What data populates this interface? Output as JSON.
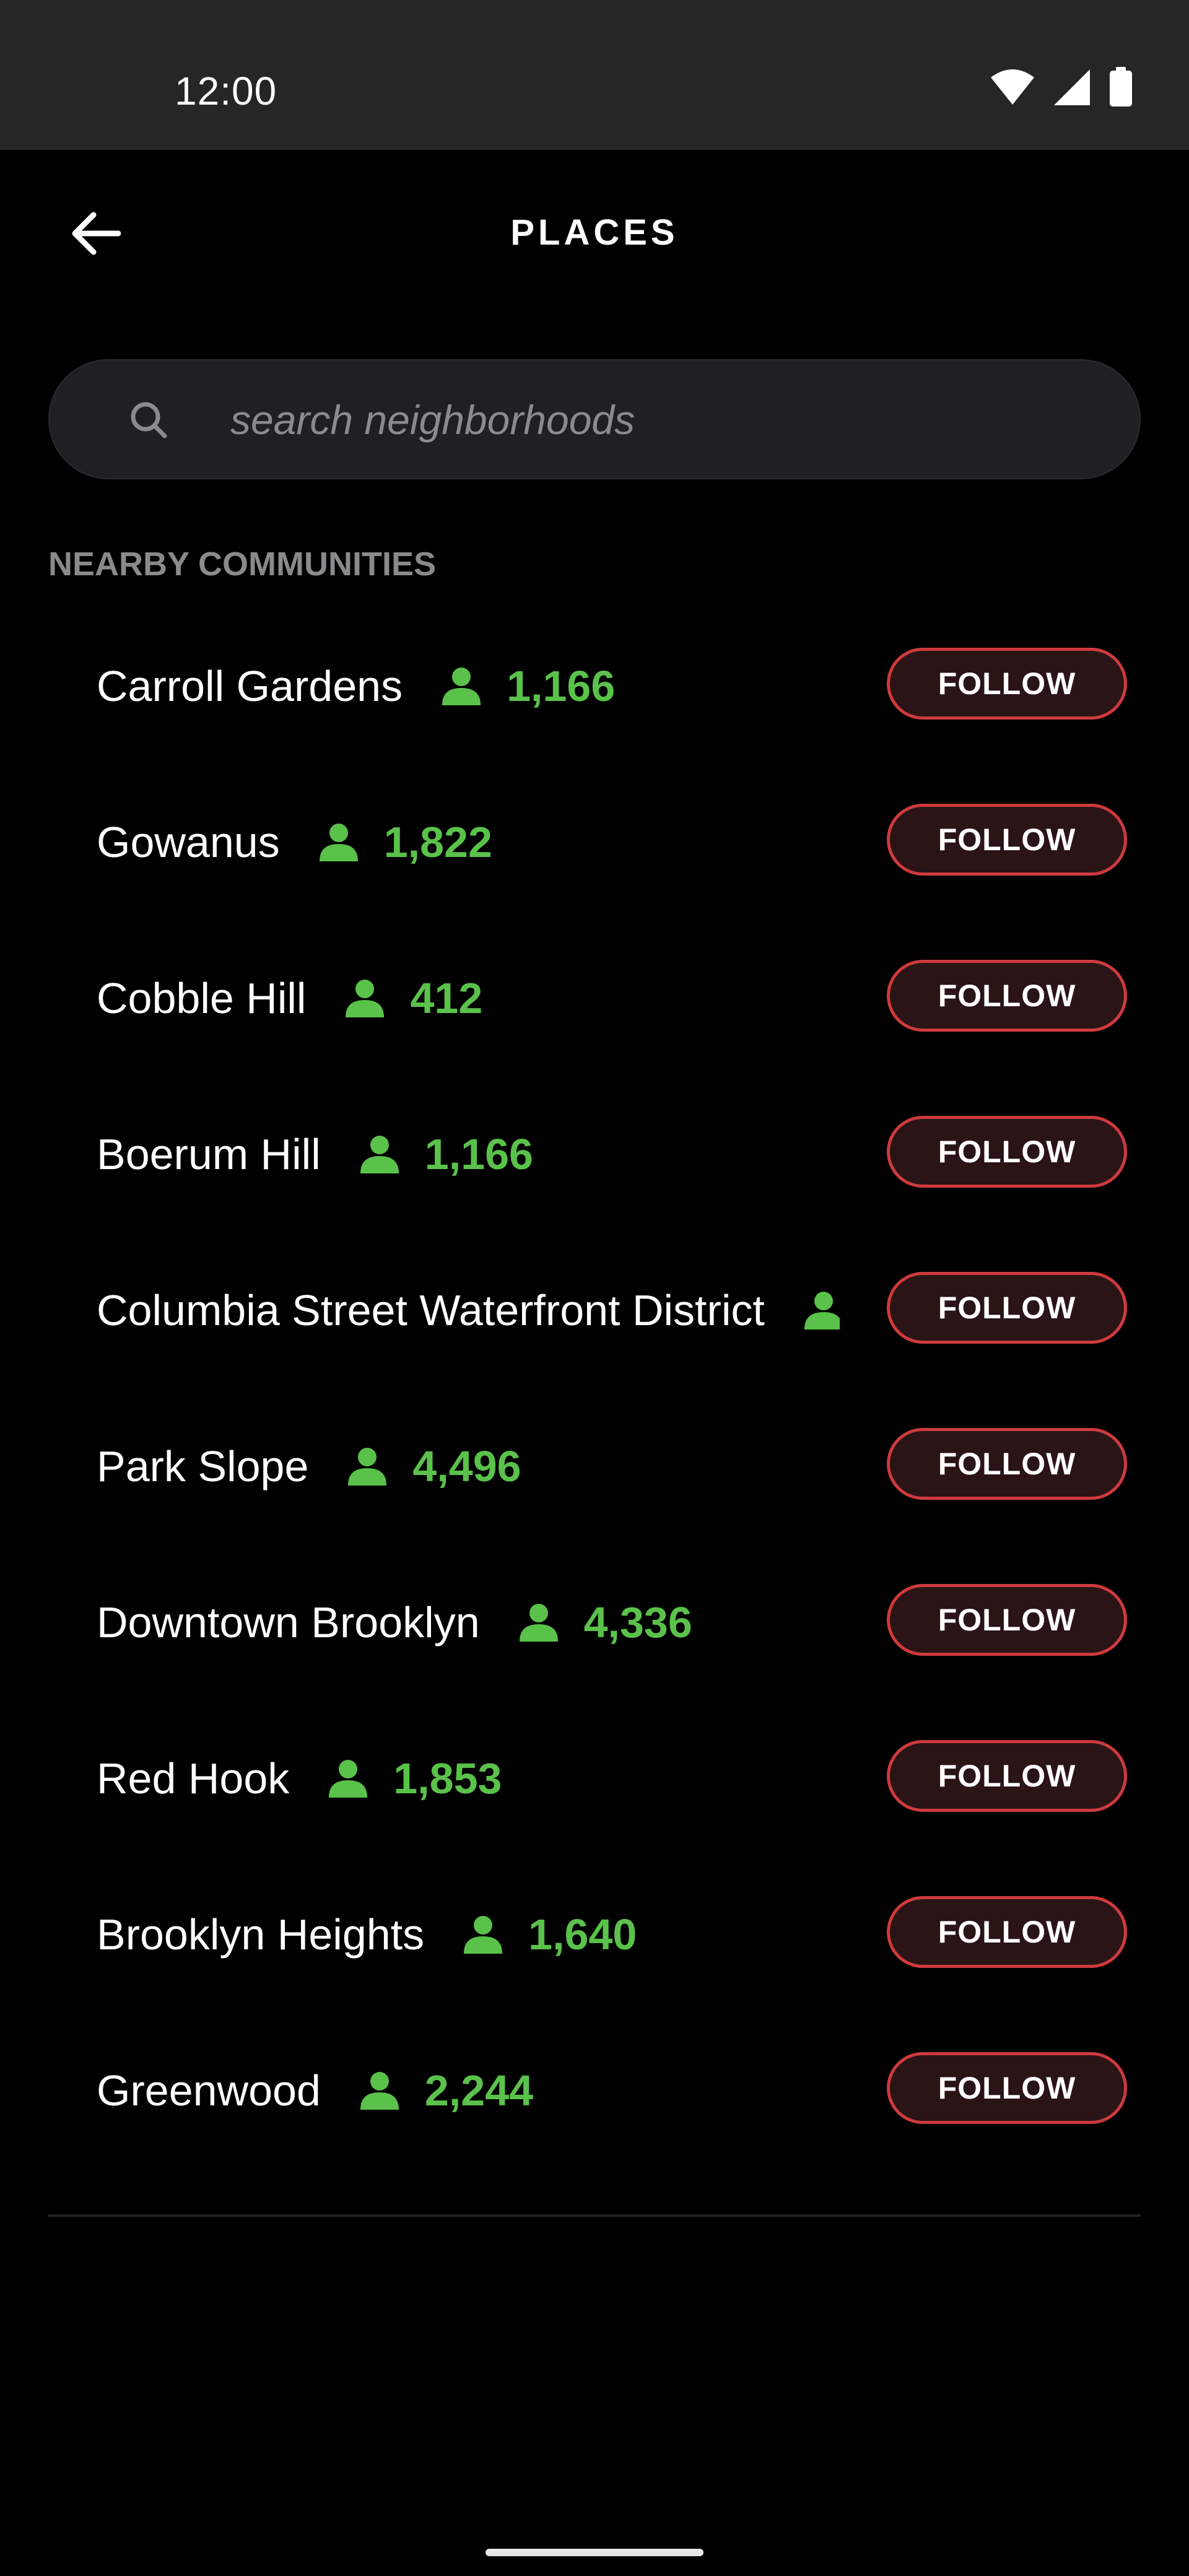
{
  "status_bar": {
    "time": "12:00",
    "icons": [
      "wifi-icon",
      "signal-icon",
      "battery-icon"
    ]
  },
  "app_bar": {
    "title": "PLACES",
    "back_icon": "arrow-left-icon"
  },
  "search": {
    "placeholder": "search neighborhoods",
    "value": "",
    "icon": "search-icon"
  },
  "section": {
    "title": "NEARBY COMMUNITIES"
  },
  "communities": [
    {
      "name": "Carroll Gardens",
      "members": "1,166",
      "follow_label": "FOLLOW"
    },
    {
      "name": "Gowanus",
      "members": "1,822",
      "follow_label": "FOLLOW"
    },
    {
      "name": "Cobble Hill",
      "members": "412",
      "follow_label": "FOLLOW"
    },
    {
      "name": "Boerum Hill",
      "members": "1,166",
      "follow_label": "FOLLOW"
    },
    {
      "name": "Columbia Street Waterfront District",
      "members": "",
      "follow_label": "FOLLOW"
    },
    {
      "name": "Park Slope",
      "members": "4,496",
      "follow_label": "FOLLOW"
    },
    {
      "name": "Downtown Brooklyn",
      "members": "4,336",
      "follow_label": "FOLLOW"
    },
    {
      "name": "Red Hook",
      "members": "1,853",
      "follow_label": "FOLLOW"
    },
    {
      "name": "Brooklyn Heights",
      "members": "1,640",
      "follow_label": "FOLLOW"
    },
    {
      "name": "Greenwood",
      "members": "2,244",
      "follow_label": "FOLLOW"
    }
  ],
  "colors": {
    "background": "#000000",
    "status_bar": "#262626",
    "accent_green": "#5ac24a",
    "follow_border": "#cf3a3d",
    "follow_fill": "#2a1416",
    "muted_text": "#8a8a8d",
    "search_fill": "#1f2023"
  }
}
